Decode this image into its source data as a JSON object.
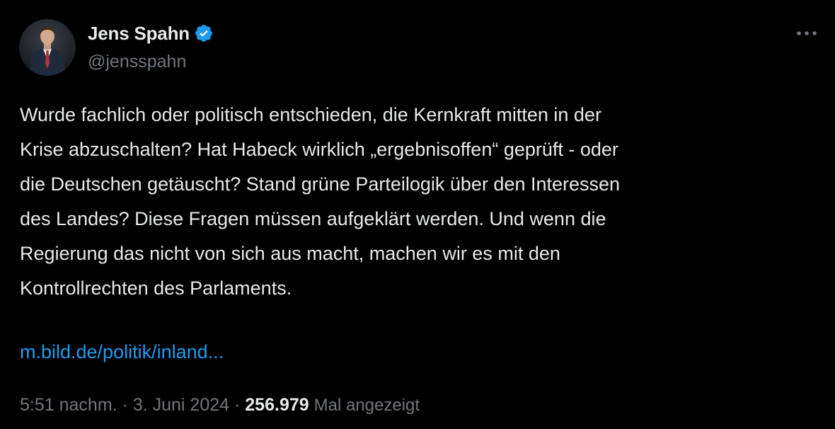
{
  "author": {
    "display_name": "Jens Spahn",
    "handle": "@jensspahn",
    "verified": true,
    "verified_color": "#1d9bf0",
    "avatar_icon": "profile-photo"
  },
  "tweet": {
    "lines": [
      "Wurde fachlich oder politisch entschieden, die Kernkraft mitten in der",
      "Krise abzuschalten? Hat Habeck wirklich „ergebnisoffen“ geprüft - oder",
      "die Deutschen getäuscht? Stand grüne Parteilogik über den Interessen",
      "des Landes? Diese Fragen müssen aufgeklärt werden. Und wenn die",
      "Regierung das nicht von sich aus macht, machen wir es mit den",
      "Kontrollrechten des Parlaments."
    ],
    "link": "m.bild.de/politik/inland..."
  },
  "meta": {
    "time": "5:51 nachm.",
    "separator": "·",
    "date": "3. Juni 2024",
    "views_count": "256.979",
    "views_label": "Mal angezeigt"
  },
  "colors": {
    "background": "#000000",
    "text": "#e7e9ea",
    "secondary": "#71767b",
    "link": "#1d9bf0"
  },
  "icons": {
    "more": "more-horizontal-icon",
    "verified": "verified-badge-icon"
  }
}
